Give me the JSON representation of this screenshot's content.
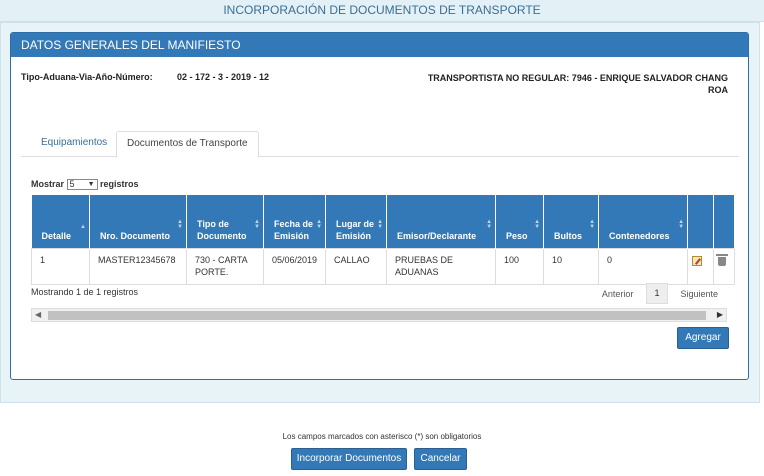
{
  "page": {
    "title": "INCORPORACIÓN DE DOCUMENTOS DE TRANSPORTE"
  },
  "panel": {
    "title": "DATOS GENERALES DEL MANIFIESTO",
    "id_label": "Tipo-Aduana-Via-Año-Número:",
    "id_value": "02 - 172 - 3 - 2019 - 12",
    "carrier": "TRANSPORTISTA NO REGULAR: 7946 - ENRIQUE SALVADOR CHANG ROA"
  },
  "tabs": [
    {
      "label": "Equipamientos",
      "active": false
    },
    {
      "label": "Documentos de Transporte",
      "active": true
    }
  ],
  "table_controls": {
    "show_label": "Mostrar",
    "page_size": "5",
    "records_label": "registros",
    "showing": "Mostrando 1 de 1 registros",
    "prev": "Anterior",
    "current_page": "1",
    "next": "Siguiente"
  },
  "table": {
    "columns": [
      "Detalle",
      "Nro. Documento",
      "Tipo de Documento",
      "Fecha de Emisión",
      "Lugar de Emisión",
      "Emisor/Declarante",
      "Peso",
      "Bultos",
      "Contenedores"
    ],
    "rows": [
      [
        "1",
        "MASTER12345678",
        "730 - CARTA PORTE.",
        "05/06/2019",
        "CALLAO",
        "PRUEBAS DE ADUANAS",
        "100",
        "10",
        "0"
      ]
    ]
  },
  "buttons": {
    "add": "Agregar",
    "incorporate": "Incorporar Documentos",
    "cancel": "Cancelar"
  },
  "footer": {
    "note": "Los campos marcados con asterisco (*) son obligatorios"
  },
  "colors": {
    "header_blue": "#3379b7",
    "bg_light": "#e8f3f7"
  }
}
